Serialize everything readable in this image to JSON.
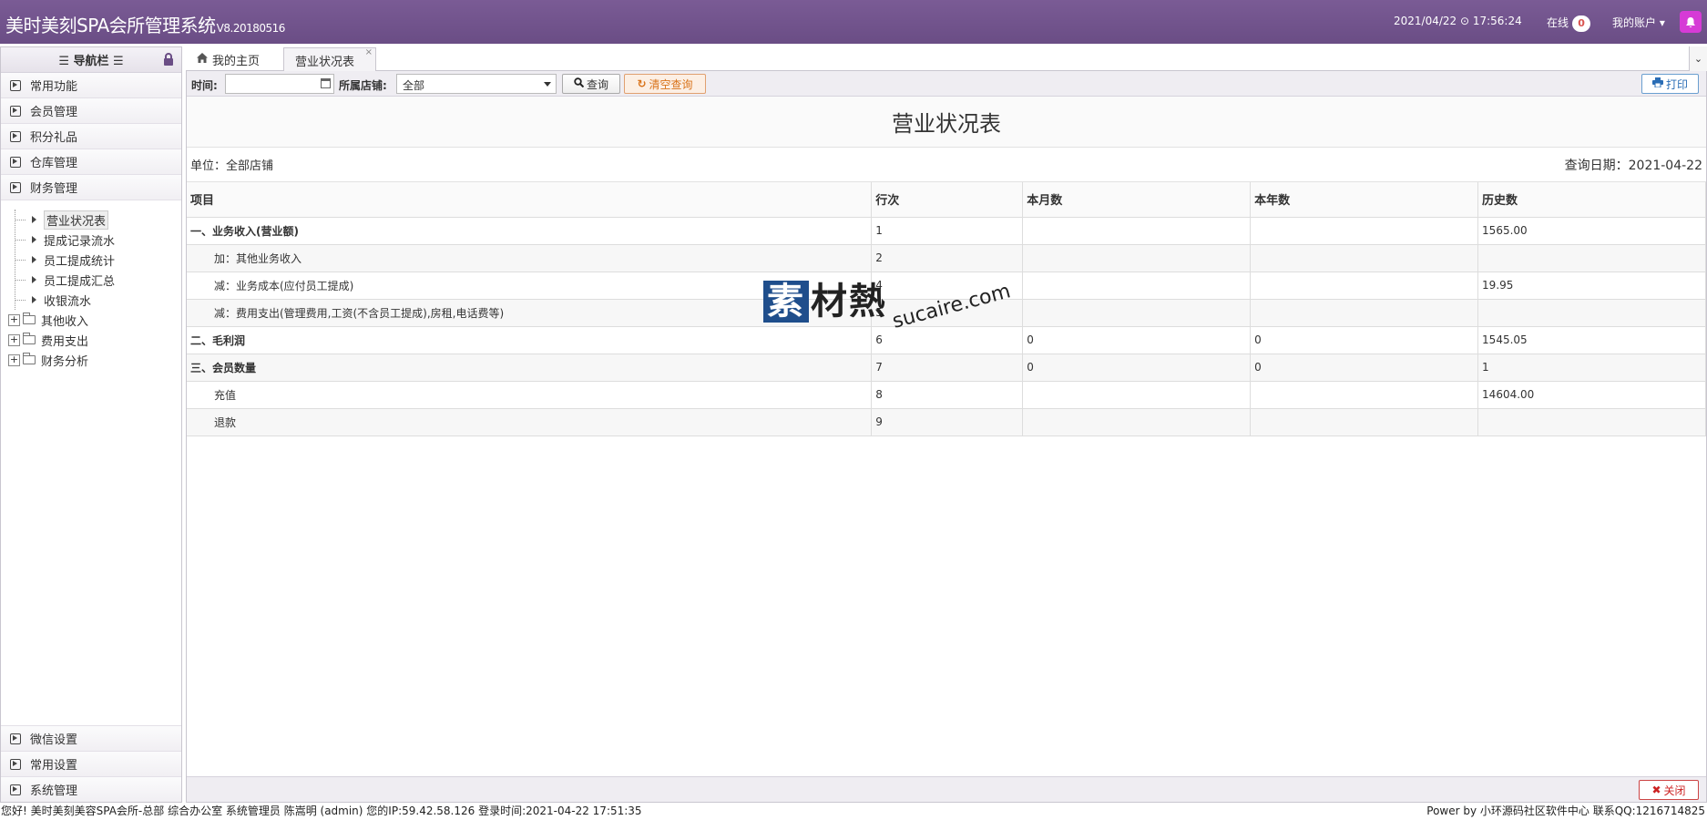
{
  "header": {
    "title": "美时美刻SPA会所管理系统",
    "version": "V8.20180516",
    "datetime": "2021/04/22 ⊙ 17:56:24",
    "online_label": "在线",
    "online_count": "0",
    "account_label": "我的账户 ▾"
  },
  "sidebar": {
    "title": "☰ 导航栏 ☰",
    "groups": [
      "常用功能",
      "会员管理",
      "积分礼品",
      "仓库管理",
      "财务管理"
    ],
    "tree": {
      "leaves": [
        "营业状况表",
        "提成记录流水",
        "员工提成统计",
        "员工提成汇总",
        "收银流水"
      ],
      "folders": [
        "其他收入",
        "费用支出",
        "财务分析"
      ]
    },
    "bottom_groups": [
      "微信设置",
      "常用设置",
      "系统管理"
    ]
  },
  "tabs": {
    "home": "我的主页",
    "active": "营业状况表",
    "close": "×"
  },
  "toolbar": {
    "time_label": "时间:",
    "time_value": "",
    "store_label": "所属店铺:",
    "store_value": "全部",
    "query_label": "查询",
    "clear_label": "清空查询",
    "print_label": "打印"
  },
  "report": {
    "title": "营业状况表",
    "unit": "单位：全部店铺",
    "query_date": "查询日期：2021-04-22",
    "columns": [
      "项目",
      "行次",
      "本月数",
      "本年数",
      "历史数"
    ],
    "rows": [
      {
        "item": "一、业务收入(营业额)",
        "line": "1",
        "month": "",
        "year": "",
        "history": "1565.00",
        "bold": true
      },
      {
        "item": "加：其他业务收入",
        "line": "2",
        "month": "",
        "year": "",
        "history": "",
        "indent": true
      },
      {
        "item": "减：业务成本(应付员工提成)",
        "line": "4",
        "month": "",
        "year": "",
        "history": "19.95",
        "indent": true
      },
      {
        "item": "减：费用支出(管理费用,工资(不含员工提成),房租,电话费等)",
        "line": "5",
        "month": "",
        "year": "",
        "history": "",
        "indent": true
      },
      {
        "item": "二、毛利润",
        "line": "6",
        "month": "0",
        "year": "0",
        "history": "1545.05",
        "bold": true
      },
      {
        "item": "三、会员数量",
        "line": "7",
        "month": "0",
        "year": "0",
        "history": "1",
        "bold": true
      },
      {
        "item": "充值",
        "line": "8",
        "month": "",
        "year": "",
        "history": "14604.00",
        "indent": true
      },
      {
        "item": "退款",
        "line": "9",
        "month": "",
        "year": "",
        "history": "",
        "indent": true
      }
    ]
  },
  "watermark": {
    "cn_box": "素",
    "cn_rest": "材熱",
    "en": "sucaire.com"
  },
  "footer": {
    "close_label": "关闭"
  },
  "statusbar": {
    "left": "您好! 美时美刻美容SPA会所-总部 综合办公室 系统管理员 陈嵩明 (admin) 您的IP:59.42.58.126 登录时间:2021-04-22 17:51:35",
    "right": "Power by 小环源码社区软件中心 联系QQ:1216714825"
  },
  "colors": {
    "header_bg": "#6a4d85",
    "bell_bg": "#d63bd6",
    "clear_button": "#d9731a",
    "print_button": "#2a6db5",
    "close_button": "#cc2222"
  }
}
